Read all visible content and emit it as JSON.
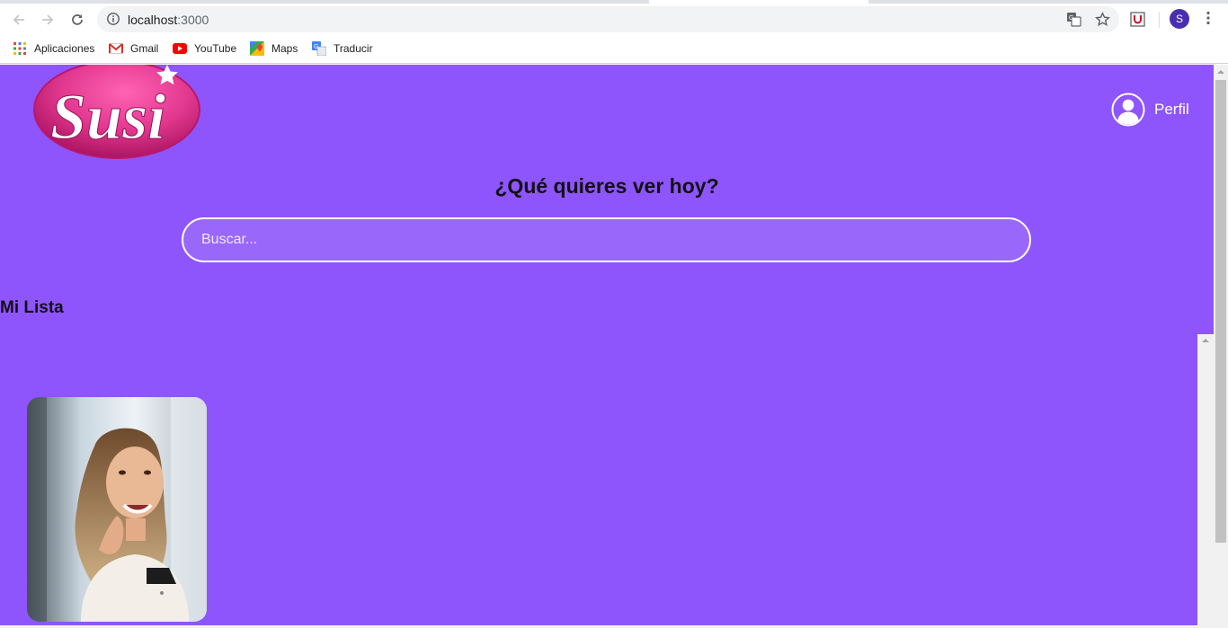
{
  "browser": {
    "url_host": "localhost",
    "url_port": ":3000",
    "profile_initial": "S",
    "bookmarks": [
      "Aplicaciones",
      "Gmail",
      "YouTube",
      "Maps",
      "Traducir"
    ]
  },
  "header": {
    "logo_text": "Susi",
    "profile_label": "Perfil"
  },
  "main": {
    "headline": "¿Qué quieres ver hoy?",
    "search_placeholder": "Buscar...",
    "list_title": "Mi Lista"
  },
  "colors": {
    "page_background": "#8e55fd",
    "logo_pink": "#d62a80",
    "avatar_purple": "#4a2eb0"
  },
  "icons": [
    "back-icon",
    "forward-icon",
    "reload-icon",
    "info-icon",
    "translate-icon",
    "star-icon",
    "extension-icon",
    "menu-dots-icon",
    "apps-grid-icon",
    "gmail-icon",
    "youtube-icon",
    "maps-icon",
    "translate-bookmark-icon",
    "user-icon"
  ]
}
